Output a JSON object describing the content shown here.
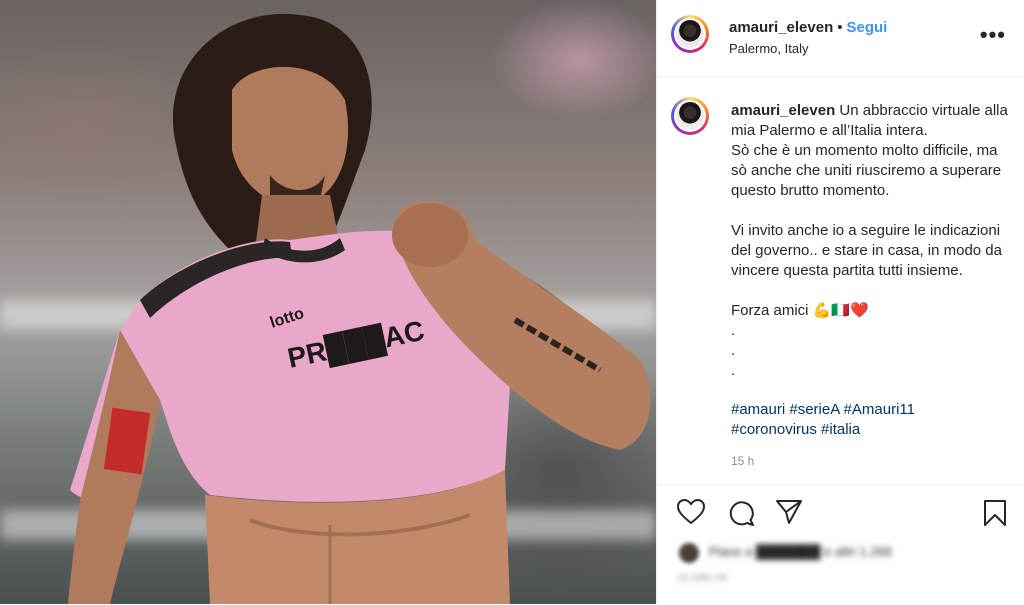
{
  "header": {
    "username": "amauri_eleven",
    "separator": "•",
    "follow_label": "Segui",
    "location": "Palermo, Italy",
    "more_label": "•••"
  },
  "caption": {
    "username": "amauri_eleven",
    "text": " Un abbraccio virtuale alla mia Palermo e all’Italia intera.\nSò che è un momento molto difficile, ma sò anche che uniti riusciremo a superare questo brutto momento.\n\nVi invito anche io a seguire le indicazioni del governo.. e stare in casa, in modo da vincere questa partita tutti insieme.\n\nForza amici 💪🇮🇹❤️\n.\n.\n.",
    "hashtags": "#amauri #serieA #Amauri11\n#coronovirus #italia",
    "timestamp": "15 h"
  },
  "actions": {
    "icons": [
      "heart-icon",
      "comment-icon",
      "share-icon",
      "bookmark-icon"
    ],
    "likes_text": "Piace a ███████ e altri 1.266",
    "date_text": "15 ORE FA"
  },
  "photo": {
    "jersey_text": "PR███AC",
    "sponsor_text": "lotto",
    "colors": {
      "jersey": "#e9a7c9",
      "trim": "#2a2626",
      "follow": "#3897f0",
      "hashtag": "#003569"
    }
  }
}
